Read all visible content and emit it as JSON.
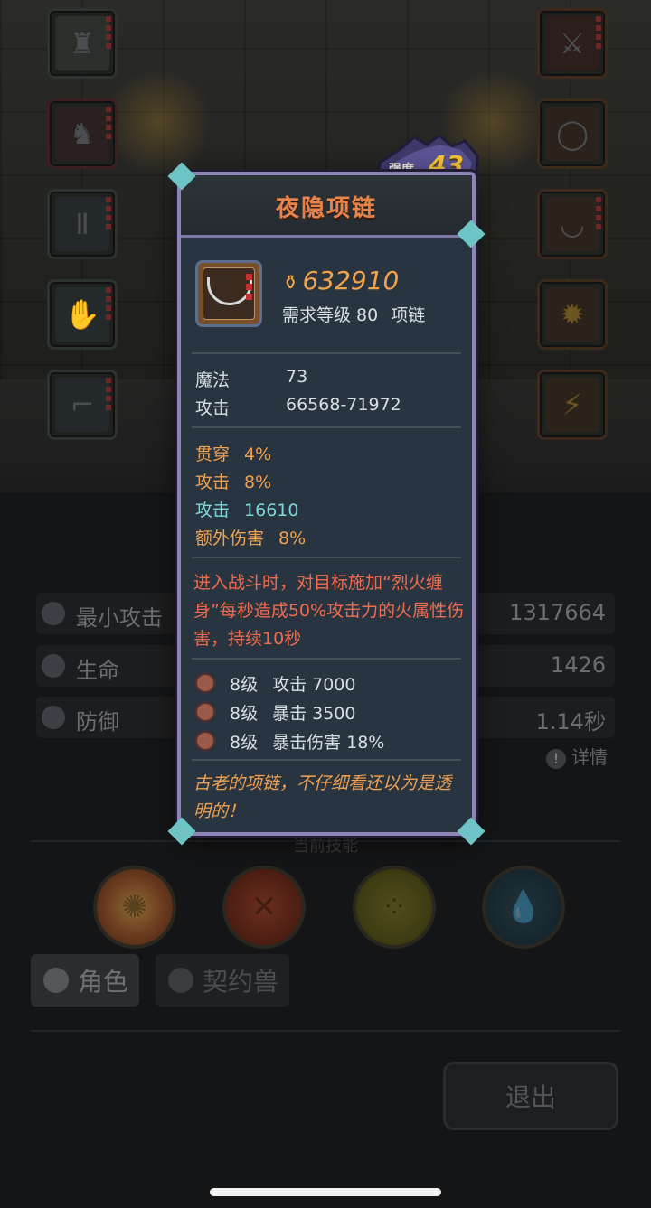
{
  "dialog": {
    "title": "夜隐项链",
    "strength_label": "强度",
    "strength_value": "43",
    "price": "632910",
    "req_level": "需求等级 80",
    "item_type": "项链",
    "base_stats": [
      {
        "label": "魔法",
        "value": "73"
      },
      {
        "label": "攻击",
        "value": "66568-71972"
      }
    ],
    "bonus_stats": [
      {
        "label": "贯穿",
        "value": "4%",
        "color": "#f0a050"
      },
      {
        "label": "攻击",
        "value": "8%",
        "color": "#f0a050"
      },
      {
        "label": "攻击",
        "value": "16610",
        "color": "#7fd7dc"
      },
      {
        "label": "额外伤害",
        "value": "8%",
        "color": "#f0a050"
      }
    ],
    "special_effect": "进入战斗时，对目标施加“烈火缠身”每秒造成50%攻击力的火属性伤害，持续10秒",
    "gems": [
      {
        "level": "8级",
        "effect": "攻击 7000"
      },
      {
        "level": "8级",
        "effect": "暴击 3500"
      },
      {
        "level": "8级",
        "effect": "暴击伤害 18%"
      }
    ],
    "flavor": "古老的项链，不仔细看还以为是透明的！"
  },
  "stats": [
    {
      "label": "最小攻击",
      "value": "1317664",
      "icon": "sword-icon"
    },
    {
      "label": "生命",
      "value": "1426",
      "icon": "heart-icon"
    },
    {
      "label": "防御",
      "value": "1.14秒",
      "icon": "shield-icon"
    }
  ],
  "detail_link": "详情",
  "skills_title": "当前技能",
  "tabs": {
    "role": "角色",
    "pet": "契约兽"
  },
  "exit_label": "退出"
}
